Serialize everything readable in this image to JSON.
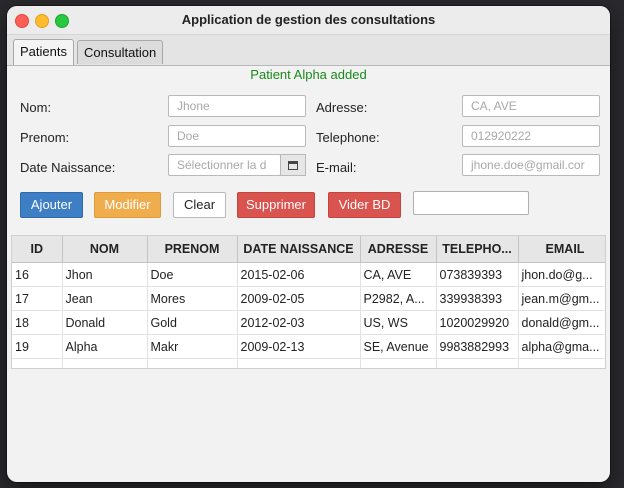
{
  "window": {
    "title": "Application de gestion des consultations"
  },
  "tabs": [
    {
      "label": "Patients",
      "active": true
    },
    {
      "label": "Consultation",
      "active": false
    }
  ],
  "status_message": "Patient Alpha added",
  "form": {
    "nom": {
      "label": "Nom:",
      "placeholder": "Jhone",
      "value": ""
    },
    "prenom": {
      "label": "Prenom:",
      "placeholder": "Doe",
      "value": ""
    },
    "date_naissance": {
      "label": "Date Naissance:",
      "placeholder": "Sélectionner la d",
      "value": ""
    },
    "adresse": {
      "label": "Adresse:",
      "placeholder": "CA, AVE",
      "value": ""
    },
    "telephone": {
      "label": "Telephone:",
      "placeholder": "012920222",
      "value": ""
    },
    "email": {
      "label": "E-mail:",
      "placeholder": "jhone.doe@gmail.cor",
      "value": ""
    }
  },
  "buttons": {
    "ajouter": "Ajouter",
    "modifier": "Modifier",
    "clear": "Clear",
    "supprimer": "Supprimer",
    "vider_bd": "Vider BD"
  },
  "vider_input_value": "",
  "table": {
    "columns": [
      "ID",
      "NOM",
      "PRENOM",
      "DATE NAISSANCE",
      "ADRESSE",
      "TELEPHO...",
      "EMAIL"
    ],
    "rows": [
      [
        "16",
        "Jhon",
        "Doe",
        "2015-02-06",
        "CA, AVE",
        "073839393",
        "jhon.do@g..."
      ],
      [
        "17",
        "Jean",
        "Mores",
        "2009-02-05",
        "P2982, A...",
        "339938393",
        "jean.m@gm..."
      ],
      [
        "18",
        "Donald",
        "Gold",
        "2012-02-03",
        "US, WS",
        "1020029920",
        "donald@gm..."
      ],
      [
        "19",
        "Alpha",
        "Makr",
        "2009-02-13",
        "SE, Avenue",
        "9983882993",
        "alpha@gma..."
      ]
    ]
  },
  "colors": {
    "status_text": "#1a8a1a",
    "ajouter": "#3d7ec4",
    "modifier": "#f0ad4e",
    "supprimer": "#d9534f",
    "vider_bd": "#d9534f"
  },
  "icons": {
    "date_picker": "calendar-icon"
  }
}
